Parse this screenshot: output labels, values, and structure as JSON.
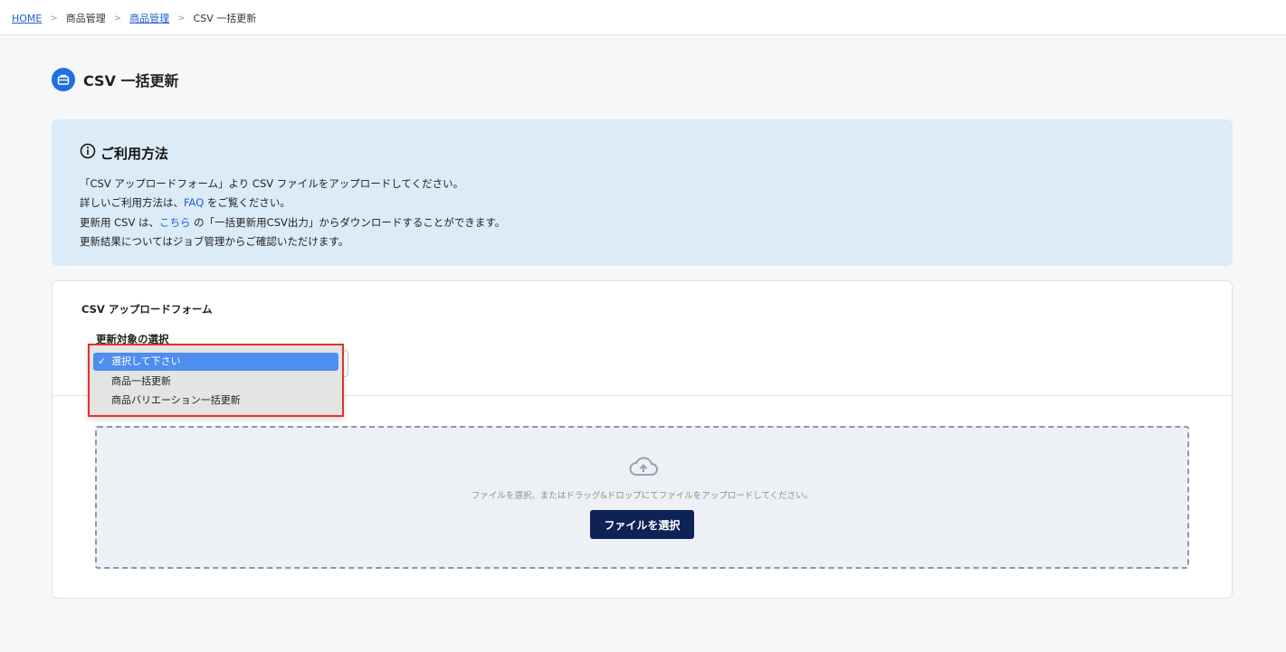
{
  "breadcrumb": {
    "home": "HOME",
    "product_mgmt": "商品管理",
    "product_mgmt_link": "商品管理",
    "current": "CSV 一括更新",
    "separator": ">"
  },
  "page": {
    "title": "CSV 一括更新",
    "icon": "package-icon"
  },
  "info": {
    "heading": "ご利用方法",
    "line1": "「CSV アップロードフォーム」より CSV ファイルをアップロードしてください。",
    "line2_pre": "詳しいご利用方法は、",
    "line2_link": "FAQ",
    "line2_post": " をご覧ください。",
    "line3_pre": "更新用 CSV は、",
    "line3_link": "こちら",
    "line3_post": " の「一括更新用CSV出力」からダウンロードすることができます。",
    "line4": "更新結果についてはジョブ管理からご確認いただけます。"
  },
  "form": {
    "title": "CSV アップロードフォーム",
    "select_label": "更新対象の選択",
    "options": [
      {
        "label": "選択して下さい",
        "selected": true
      },
      {
        "label": "商品一括更新",
        "selected": false
      },
      {
        "label": "商品バリエーション一括更新",
        "selected": false
      }
    ],
    "check_mark": "✓",
    "dropzone_text": "ファイルを選択、またはドラッグ&ドロップにてファイルをアップロードしてください。",
    "file_button": "ファイルを選択"
  },
  "colors": {
    "accent": "#1f6fe5",
    "button": "#0e2256",
    "info_bg": "#dcebf8",
    "highlight_border": "#e0342a",
    "selected_option": "#4d8ef0"
  }
}
